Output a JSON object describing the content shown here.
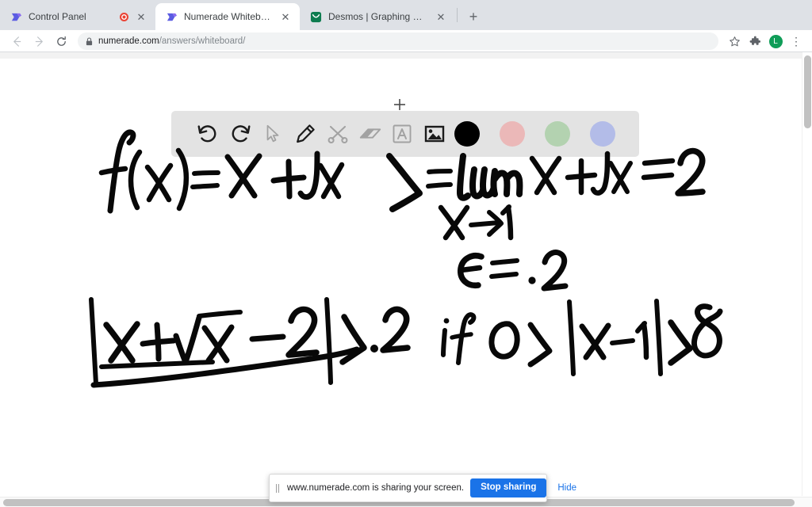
{
  "browser": {
    "tabs": [
      {
        "title": "Control Panel",
        "favicon": "numerade-icon",
        "active": false,
        "recording": true,
        "close_label": "✕"
      },
      {
        "title": "Numerade Whiteboard",
        "favicon": "numerade-icon",
        "active": true,
        "recording": false,
        "close_label": "✕"
      },
      {
        "title": "Desmos | Graphing Calculator",
        "favicon": "desmos-icon",
        "active": false,
        "recording": false,
        "close_label": "✕"
      }
    ],
    "new_tab_label": "+",
    "nav": {
      "back": "←",
      "forward": "→",
      "reload": "⟳"
    },
    "omnibox": {
      "lock_icon": "lock-icon",
      "url_domain": "numerade.com",
      "url_path": "/answers/whiteboard/",
      "url_full": "numerade.com/answers/whiteboard/"
    },
    "toolbar_icons": {
      "bookmark": "☆",
      "extensions": "puzzle-icon",
      "profile_initial": "L",
      "menu": "⋮"
    }
  },
  "whiteboard": {
    "toolbar": [
      {
        "name": "undo",
        "icon": "undo-icon",
        "enabled": true
      },
      {
        "name": "redo",
        "icon": "redo-icon",
        "enabled": true
      },
      {
        "name": "select",
        "icon": "cursor-icon",
        "enabled": false
      },
      {
        "name": "pencil",
        "icon": "pencil-icon",
        "enabled": true
      },
      {
        "name": "shapes",
        "icon": "scissors-icon",
        "enabled": false
      },
      {
        "name": "eraser",
        "icon": "eraser-icon",
        "enabled": false
      },
      {
        "name": "text",
        "icon": "text-a-icon",
        "enabled": false
      },
      {
        "name": "image",
        "icon": "image-icon",
        "enabled": true
      }
    ],
    "colors": [
      {
        "name": "black",
        "hex": "#000000",
        "selected": true
      },
      {
        "name": "pink",
        "hex": "#ebb8b8",
        "selected": false
      },
      {
        "name": "green",
        "hex": "#b3d2b0",
        "selected": false
      },
      {
        "name": "periwinkle",
        "hex": "#b3bce8",
        "selected": false
      }
    ],
    "ink_notes": [
      "f(x)= x+√x",
      "L= lim x+√x = 2",
      "x→1",
      "ε = .2",
      "|x+√x −2| < .2",
      "if 0 < |x−1| < δ"
    ],
    "cursor": "crosshair"
  },
  "share_bar": {
    "message": "www.numerade.com is sharing your screen.",
    "stop_label": "Stop sharing",
    "hide_label": "Hide",
    "accent": "#1a73e8"
  },
  "scrollbars": {
    "vertical": true,
    "horizontal": true
  }
}
